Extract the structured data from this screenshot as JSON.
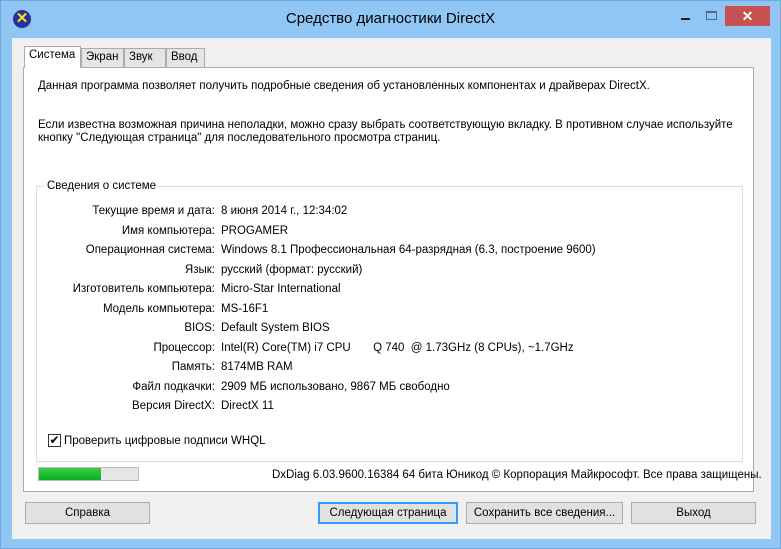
{
  "window": {
    "title": "Средство диагностики DirectX",
    "close": "✕"
  },
  "tabs": [
    "Система",
    "Экран",
    "Звук",
    "Ввод"
  ],
  "intro": [
    "Данная программа позволяет получить подробные сведения об установленных компонентах и драйверах DirectX.",
    "Если известна возможная причина неполадки, можно сразу выбрать соответствующую вкладку. В противном случае используйте",
    "кнопку \"Следующая страница\" для последовательного просмотра страниц."
  ],
  "system_info": {
    "title": "Сведения о системе",
    "rows": [
      {
        "label": "Текущие время и дата:",
        "value": "8 июня 2014 г., 12:34:02"
      },
      {
        "label": "Имя компьютера:",
        "value": "PROGAMER"
      },
      {
        "label": "Операционная система:",
        "value": "Windows 8.1 Профессиональная 64-разрядная (6.3, построение 9600)"
      },
      {
        "label": "Язык:",
        "value": "русский (формат: русский)"
      },
      {
        "label": "Изготовитель компьютера:",
        "value": "Micro-Star International"
      },
      {
        "label": "Модель компьютера:",
        "value": "MS-16F1"
      },
      {
        "label": "BIOS:",
        "value": "Default System BIOS"
      },
      {
        "label": "Процессор:",
        "value": "Intel(R) Core(TM) i7 CPU       Q 740  @ 1.73GHz (8 CPUs), ~1.7GHz"
      },
      {
        "label": "Память:",
        "value": "8174MB RAM"
      },
      {
        "label": "Файл подкачки:",
        "value": "2909 МБ использовано, 9867 МБ свободно"
      },
      {
        "label": "Версия DirectX:",
        "value": "DirectX 11"
      }
    ]
  },
  "whql": {
    "label": "Проверить цифровые подписи WHQL",
    "checked": true
  },
  "progress_percent": 63,
  "footer": "DxDiag 6.03.9600.16384 64 бита Юникод © Корпорация Майкрософт. Все права защищены.",
  "buttons": {
    "help": "Справка",
    "next": "Следующая страница",
    "save": "Сохранить все сведения...",
    "exit": "Выход"
  }
}
